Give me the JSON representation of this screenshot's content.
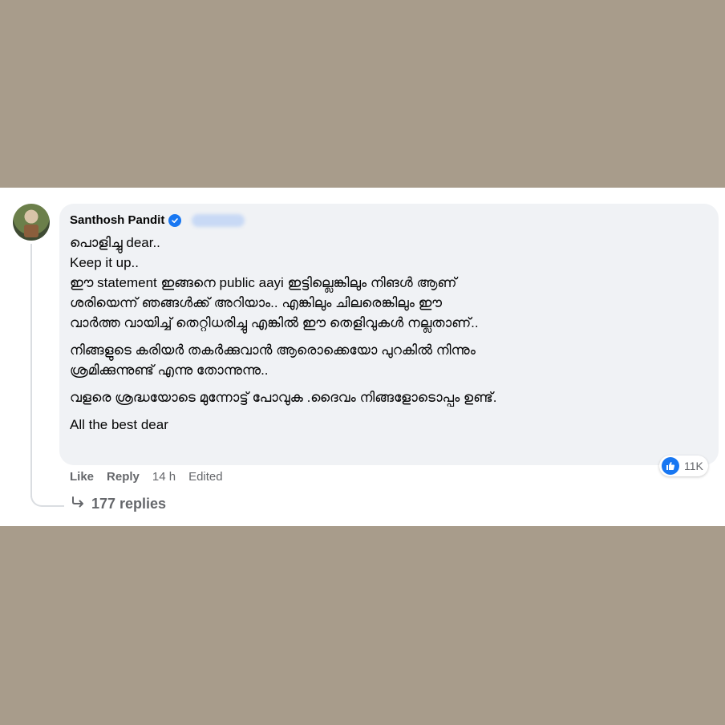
{
  "comment": {
    "author": "Santhosh Pandit",
    "lines_group1": [
      "പൊളിച്ചു dear..",
      "Keep it up..",
      "ഈ statement ഇങ്ങനെ public aayi ഇട്ടില്ലെങ്കിലും നിങൾ ആണ്",
      "ശരിയെന്ന് ഞങ്ങൾക്ക് അറിയാം.. എങ്കിലും ചിലരെങ്കിലും ഈ",
      "വാർത്ത വായിച്ച് തെറ്റിധരിച്ചു എങ്കിൽ ഈ തെളിവുകൾ നല്ലതാണ്.."
    ],
    "lines_group2": [
      "നിങ്ങളുടെ കരിയർ തകർക്കുവാൻ ആരൊക്കെയോ പുറകിൽ നിന്നും",
      "ശ്രമിക്കുന്നുണ്ട് എന്നു തോന്നുന്നു.."
    ],
    "lines_group3": [
      "വളരെ ശ്രദ്ധയോടെ മുന്നോട്ട് പോവുക .ദൈവം നിങ്ങളോടൊപ്പം ഉണ്ട്."
    ],
    "lines_group4": [
      "All the best dear"
    ],
    "reaction_count": "11K",
    "actions": {
      "like": "Like",
      "reply": "Reply",
      "time": "14 h",
      "edited": "Edited"
    },
    "replies_label": "177 replies"
  },
  "colors": {
    "background": "#a89c8b",
    "bubble": "#f0f2f5",
    "accent": "#1877f2",
    "secondary_text": "#65676b"
  },
  "icons": {
    "verified": "verified-badge-icon",
    "like": "thumbs-up-icon",
    "replies": "reply-arrow-icon"
  }
}
